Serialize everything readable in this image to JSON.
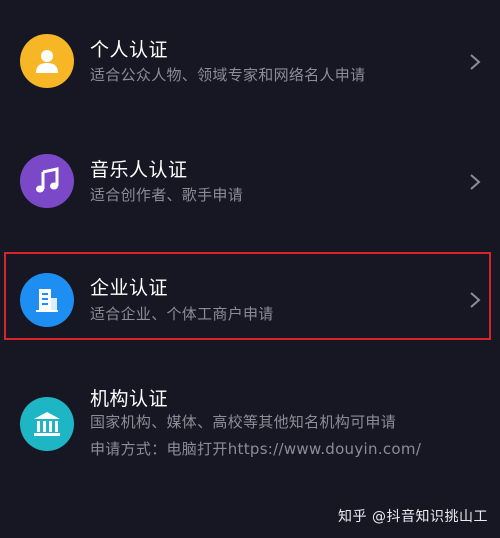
{
  "items": [
    {
      "title": "个人认证",
      "description": "适合公众人物、领域专家和网络名人申请",
      "icon": "person-icon",
      "color": "#f7b625"
    },
    {
      "title": "音乐人认证",
      "description": "适合创作者、歌手申请",
      "icon": "music-note-icon",
      "color": "#7b49c8"
    },
    {
      "title": "企业认证",
      "description": "适合企业、个体工商户申请",
      "icon": "building-icon",
      "color": "#1e8ef2"
    },
    {
      "title": "机构认证",
      "description": "国家机构、媒体、高校等其他知名机构可申请",
      "description2": "申请方式：电脑打开https://www.douyin.com/",
      "icon": "institution-icon",
      "color": "#1eb5c5"
    }
  ],
  "watermark": "知乎 @抖音知识挑山工",
  "highlight_color": "#d8232a"
}
